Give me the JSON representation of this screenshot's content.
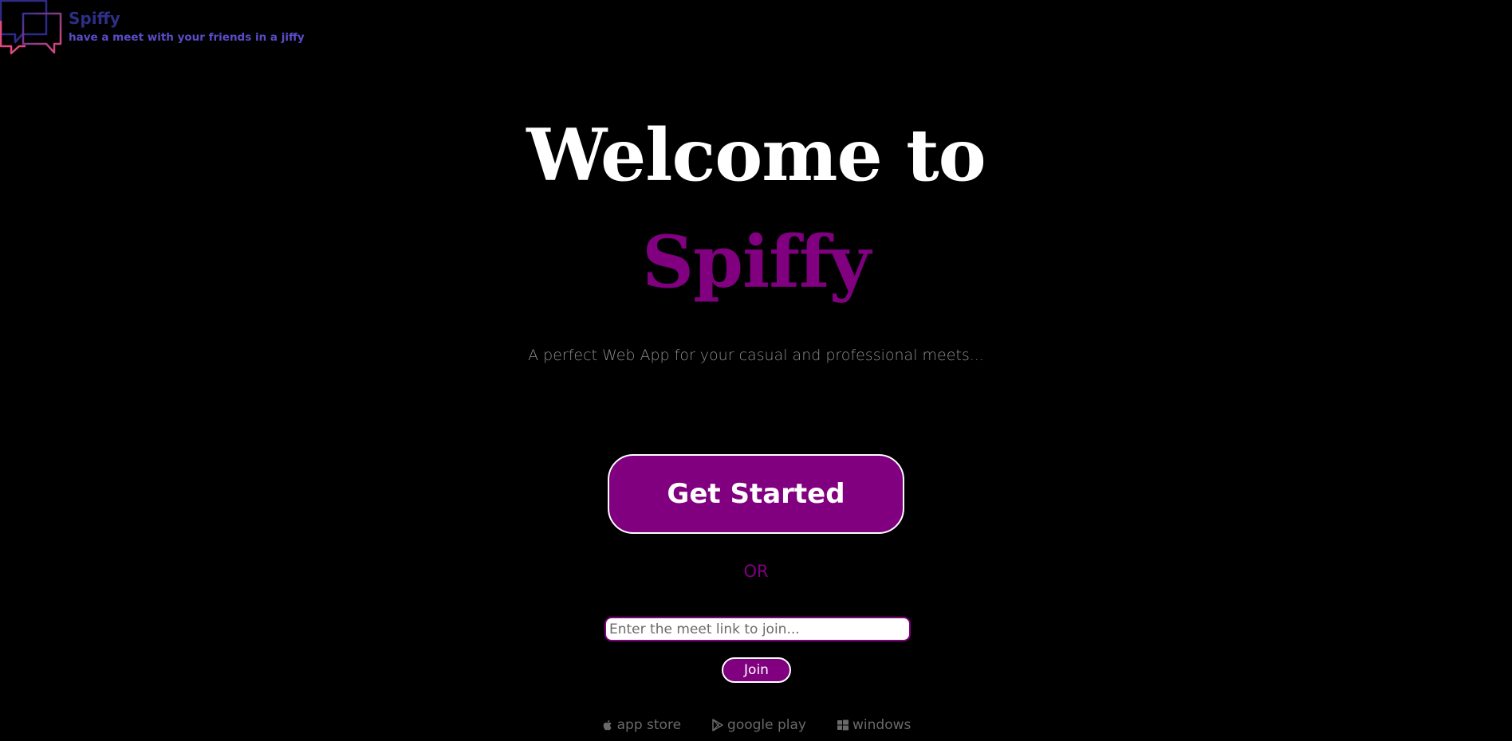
{
  "header": {
    "brand_name": "Spiffy",
    "tagline": "have a meet with your friends in a jiffy",
    "logo_icon": "chat-bubbles-icon"
  },
  "hero": {
    "title": "Welcome to",
    "brand": "Spiffy",
    "subtitle": "A perfect Web App for your casual and professional meets..."
  },
  "actions": {
    "get_started_label": "Get Started",
    "or_label": "OR",
    "meet_link_placeholder": "Enter the meet link to join...",
    "meet_link_value": "",
    "join_label": "Join"
  },
  "stores": [
    {
      "label": "app store",
      "icon": "apple-icon"
    },
    {
      "label": "google play",
      "icon": "google-play-icon"
    },
    {
      "label": "windows",
      "icon": "windows-icon"
    }
  ],
  "colors": {
    "background": "#000000",
    "accent": "#800080",
    "title": "#ffffff",
    "subtitle": "#8c8c8c",
    "brand_name": "#2d2f86",
    "tagline": "#5a4cc8",
    "logo_gradient_start": "#3b2f8f",
    "logo_gradient_end": "#e0497f"
  }
}
